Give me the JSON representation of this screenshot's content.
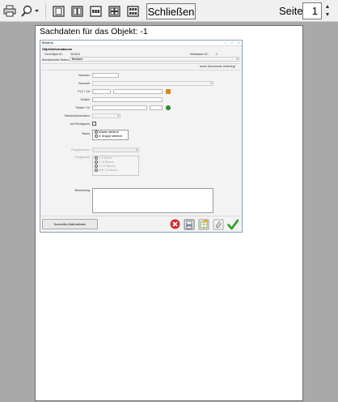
{
  "toolbar": {
    "icons": [
      "print-icon",
      "zoom-icon",
      "one-page-icon",
      "two-pages-icon",
      "three-pages-icon",
      "four-pages-icon",
      "six-pages-icon"
    ],
    "close_label": "Schließen",
    "page_label": "Seite",
    "page_value": "1"
  },
  "paper": {
    "title": "Sachdaten für das Objekt: -1"
  },
  "form": {
    "window_title": "Bedarna",
    "window_controls": [
      "–",
      "□",
      "×"
    ],
    "section_heading": "Objektinformationen",
    "geoobjekt_label": "GeoObjekt ID:",
    "geoobjekt_value": "391924",
    "metadaten_label": "Metadaten ID:",
    "metadaten_value": "-1",
    "betrieb_label": "Betriebsmittel Status:",
    "betrieb_value": "Bestand",
    "docs_note": "keine Dokumente hinterlegt",
    "nummer_label": "Nummer",
    "baumart_label": "Baumart",
    "plz_label": "PLZ / Ort",
    "ortsteil_label": "Ortsteil",
    "strasse_label": "Straße / Nr",
    "standort_label": "Standortinformation",
    "privat_label": "auf Privatgrund",
    "baum_label": "Baum",
    "radio_single": "einzeln stehend",
    "radio_group": "in Gruppe stehend",
    "gruppenname_label": "Gruppenname",
    "gruppenart_label": "Gruppenart",
    "group_options": [
      "2-5 Bäume",
      "5-10 Bäume",
      "10-20 Bäume",
      "über 20 Bäume"
    ],
    "bemerkung_label": "Bemerkung",
    "kontrollen_button": "Kontrollen Maßnahmen"
  },
  "colors": {
    "delete": "#d62b2b",
    "ok": "#35a02b",
    "map_pin": "#d08a1a",
    "gps": "#2a8a2a"
  }
}
